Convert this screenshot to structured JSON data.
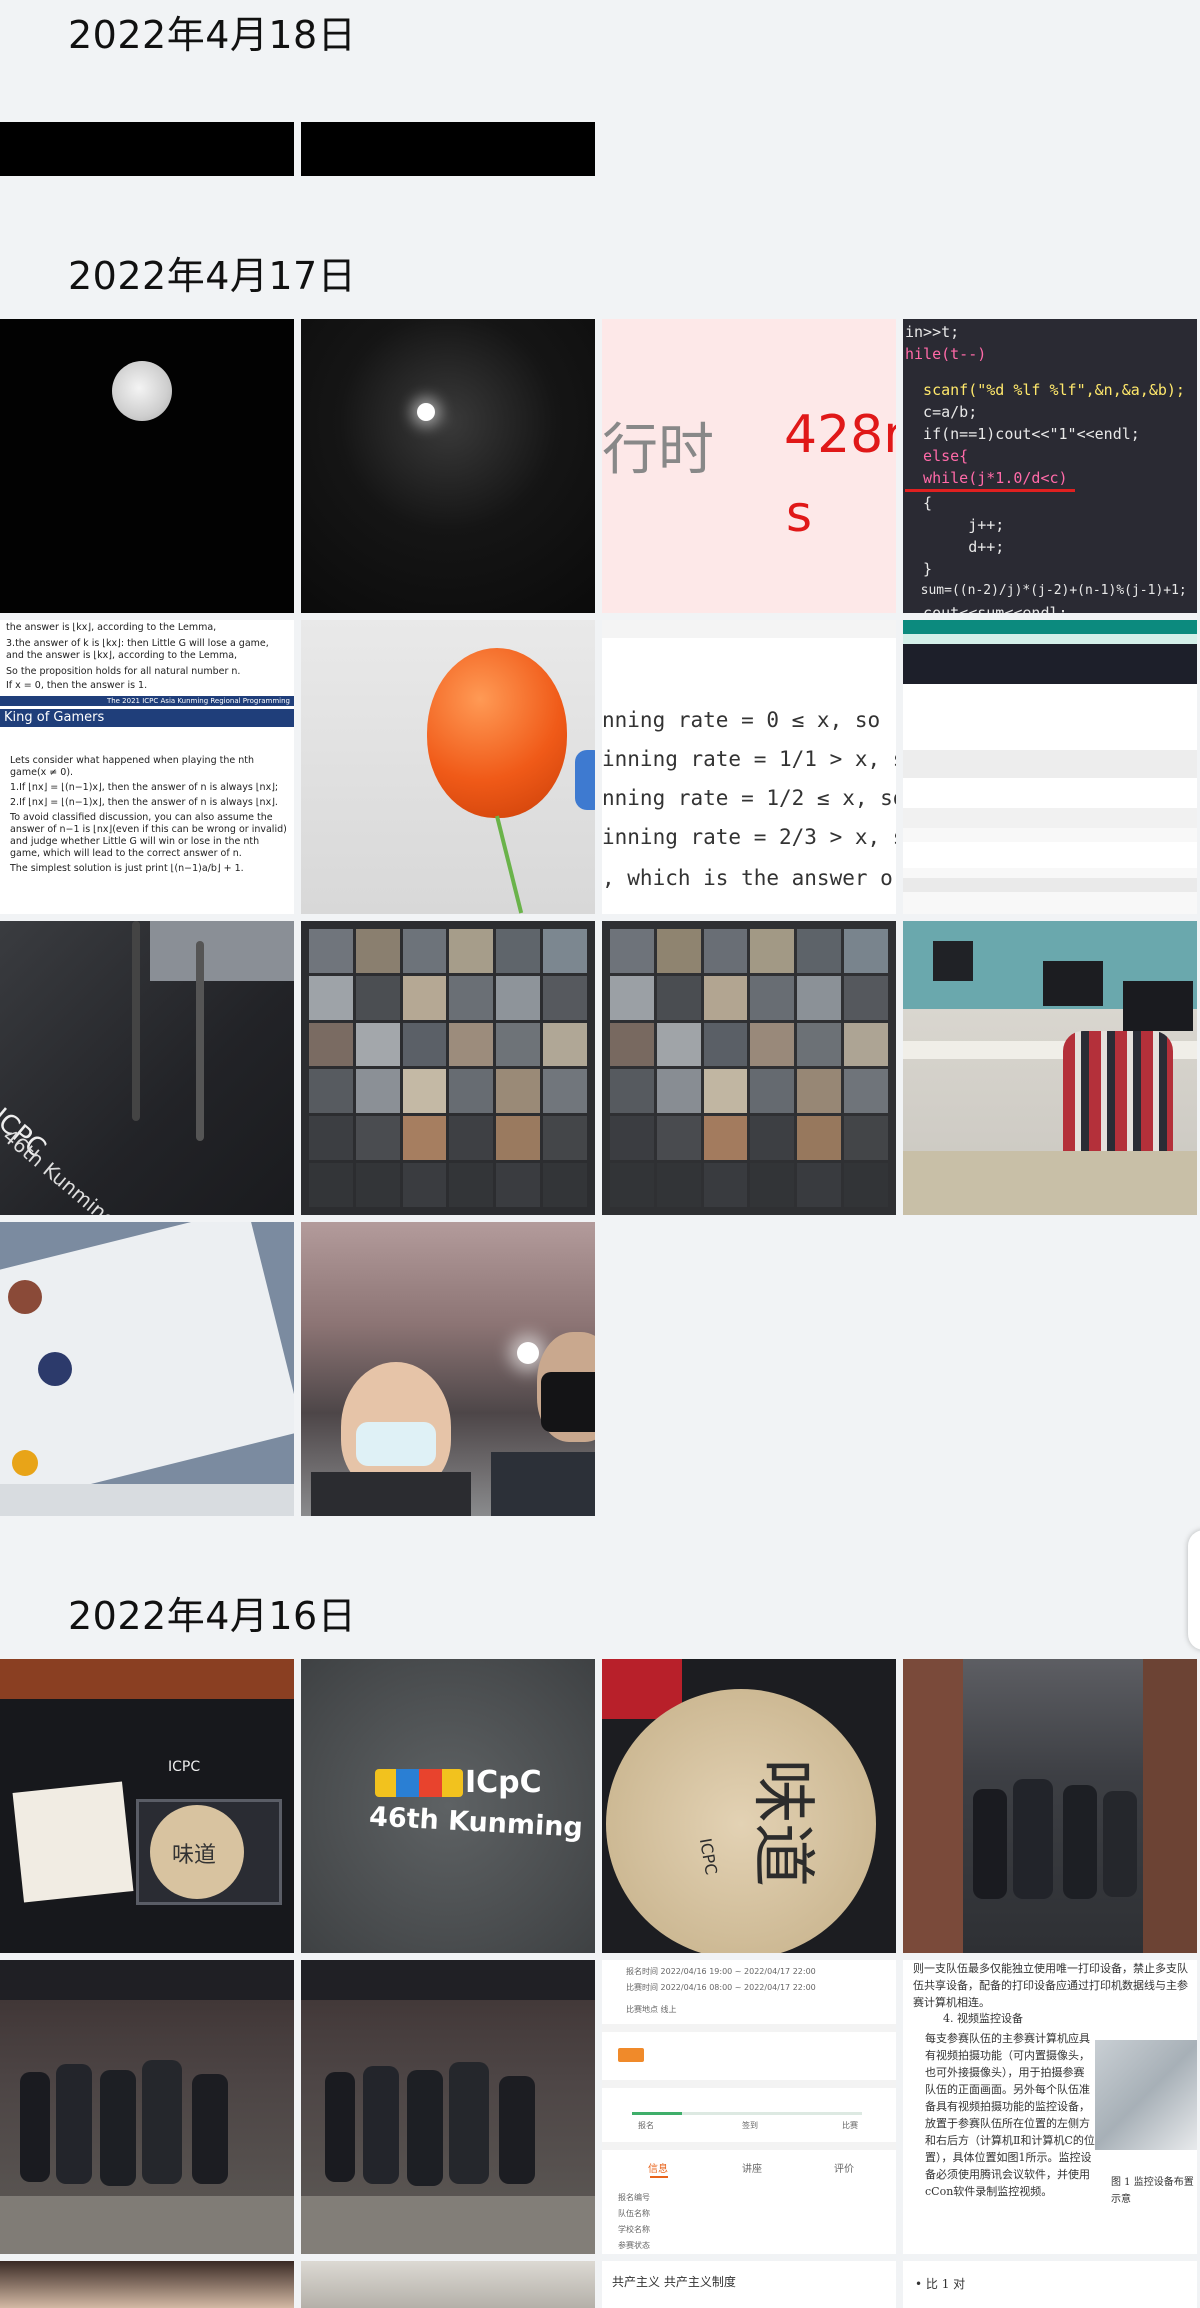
{
  "sections": [
    {
      "date": "2022年4月18日"
    },
    {
      "date": "2022年4月17日"
    },
    {
      "date": "2022年4月16日"
    }
  ],
  "photos": {
    "runtime_red": "428r",
    "runtime_gray": "行时",
    "runtime_s": "s",
    "code_lines": [
      "in>>t;",
      "hile(t--)",
      "  scanf(\"%d %lf %lf\",&n,&a,&b);",
      "  c=a/b;",
      "  if(n==1)cout<<\"1\"<<endl;",
      "  else{",
      "  while(j*1.0/d<c)",
      "  {",
      "       j++;",
      "       d++;",
      "  }",
      "  sum=((n-2)/j)*(j-2)+(n-1)%(j-1)+1;",
      "  cout<<sum<<endl;"
    ],
    "slide_title": "King of Gamers",
    "slide_bullets": [
      "Lets consider what happened when playing the nth game(x ≠ 0).",
      "1.If ⌊nx⌋ = ⌊(n−1)x⌋, then the answer of n is always ⌊nx⌋;",
      "2.If ⌊nx⌋ = ⌊(n−1)x⌋, then the answer of n is always ⌊nx⌋.",
      "To avoid classified discussion, you can also assume the answer of n−1 is ⌊nx⌋(even if this can be wrong or invalid) and judge whether Little G will win or lose in the nth game, which will lead to the correct answer of n.",
      "The simplest solution is just print ⌊(n−1)a/b⌋ + 1."
    ],
    "slide_top": [
      "the answer is ⌊kx⌋, according to the Lemma,",
      "3.the answer of k is ⌊kx⌋: then Little G will lose a game, and the answer is ⌊kx⌋, according to the Lemma,",
      "So the proposition holds for all natural number n.",
      "If x = 0, then the answer is 1."
    ],
    "slide_footer": "The 2021 ICPC Asia Kunming Regional Programming",
    "winning_lines": [
      "nning rate = 0 ≤ x, so",
      "inning rate = 1/1 > x, so",
      "nning rate = 1/2 ≤ x, so",
      "inning rate = 2/3 > x, so",
      ", which is the answer o"
    ],
    "hoodie_text": "46th Kunming",
    "hoodie_brand": "ICPC",
    "hoodie2_brand": "ICpC",
    "hoodie2_text": "46th Kunming",
    "tin_text": "46th Kunming",
    "tin_brand": "ICPC",
    "tin_char": "味道",
    "doc_paragraph": "每支参赛队伍的主参赛计算机应具有视频拍摄功能（可内置摄像头，也可外接摄像头），用于拍摄参赛队伍的正面画面。另外每个队伍准备具有视频拍摄功能的监控设备，放置于参赛队伍所在位置的左侧方和右后方（计算机Ⅱ和计算机C的位置），具体位置如图1所示。监控设备必须使用腾讯会议软件，并使用cCon软件录制监控视频。",
    "doc_heading": "4. 视频监控设备",
    "doc_top": "则一支队伍最多仅能独立使用唯一打印设备，禁止多支队伍共享设备，配备的打印设备应通过打印机数据线与主参赛计算机相连。",
    "doc_caption": "图 1  监控设备布置示意",
    "app_rows": [
      "报名时间  2022/04/16 19:00 ~ 2022/04/17 22:00",
      "比赛时间  2022/04/16 08:00 ~ 2022/04/17 22:00",
      "比赛地点  线上"
    ],
    "app_tabs": [
      "信息",
      "讲座",
      "评价"
    ],
    "app_steps": [
      "报名",
      "签到",
      "比赛"
    ],
    "app_field_labels": [
      "报名编号",
      "队伍名称",
      "学校名称",
      "参赛状态"
    ],
    "bottom_text": "共产主义  共产主义制度",
    "bottom_text2": "• 比 1 对"
  }
}
